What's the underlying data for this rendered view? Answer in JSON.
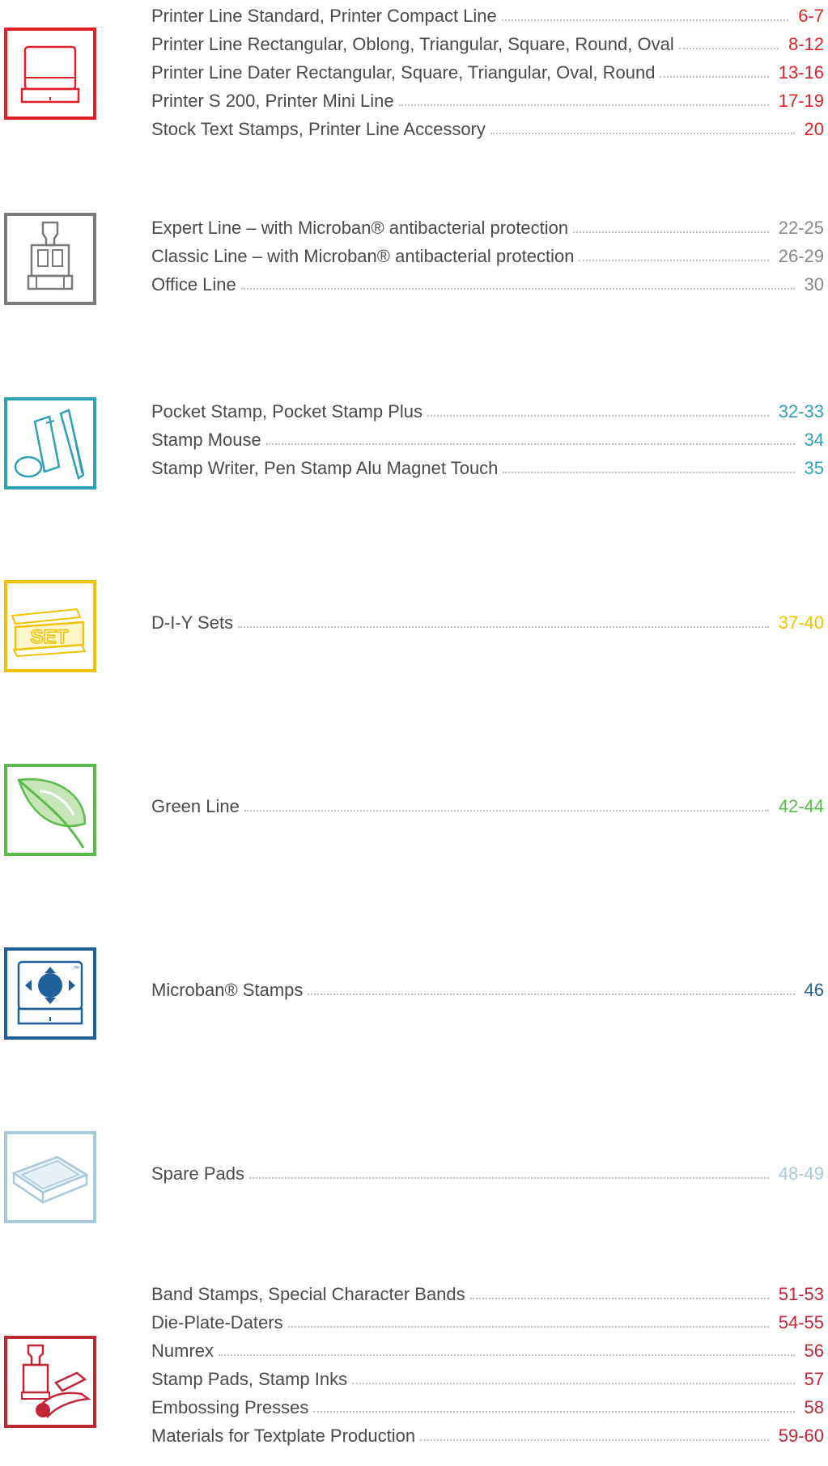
{
  "colors": {
    "printer": "#e0202a",
    "professional": "#7a7a7a",
    "mobile": "#2fa1b5",
    "diy": "#f2c200",
    "green": "#5aba4a",
    "microban": "#1f5f9a",
    "pads": "#a9c9d8",
    "traditional": "#c02636"
  },
  "sections": [
    {
      "icon": "self-inking-stamp-icon",
      "entries": [
        {
          "title": "Printer Line Standard, Printer Compact Line",
          "pages": "6-7"
        },
        {
          "title": "Printer Line Rectangular, Oblong, Triangular, Square, Round, Oval",
          "pages": "8-12"
        },
        {
          "title": "Printer Line Dater Rectangular, Square, Triangular, Oval, Round",
          "pages": "13-16"
        },
        {
          "title": "Printer S 200, Printer Mini Line",
          "pages": "17-19"
        },
        {
          "title": "Stock Text Stamps, Printer Line Accessory",
          "pages": "20"
        }
      ]
    },
    {
      "icon": "heavy-duty-stamp-icon",
      "entries": [
        {
          "title": "Expert Line – with Microban® antibacterial protection",
          "pages": "22-25"
        },
        {
          "title": "Classic Line – with Microban® antibacterial protection",
          "pages": "26-29"
        },
        {
          "title": "Office Line",
          "pages": "30"
        }
      ]
    },
    {
      "icon": "pocket-stamp-icon",
      "entries": [
        {
          "title": "Pocket Stamp, Pocket Stamp Plus",
          "pages": "32-33"
        },
        {
          "title": "Stamp Mouse",
          "pages": "34"
        },
        {
          "title": "Stamp Writer, Pen Stamp Alu Magnet Touch",
          "pages": "35"
        }
      ]
    },
    {
      "icon": "diy-set-icon",
      "icon_text": "SET",
      "entries": [
        {
          "title": "D-I-Y Sets",
          "pages": "37-40"
        }
      ]
    },
    {
      "icon": "leaf-icon",
      "entries": [
        {
          "title": "Green Line",
          "pages": "42-44"
        }
      ]
    },
    {
      "icon": "microban-stamp-icon",
      "icon_text": "™",
      "entries": [
        {
          "title": "Microban® Stamps",
          "pages": "46"
        }
      ]
    },
    {
      "icon": "spare-pad-icon",
      "entries": [
        {
          "title": "Spare Pads",
          "pages": "48-49"
        }
      ]
    },
    {
      "icon": "embossing-press-icon",
      "entries": [
        {
          "title": "Band Stamps, Special Character Bands",
          "pages": "51-53"
        },
        {
          "title": "Die-Plate-Daters",
          "pages": "54-55"
        },
        {
          "title": "Numrex",
          "pages": "56"
        },
        {
          "title": "Stamp Pads, Stamp Inks",
          "pages": "57"
        },
        {
          "title": "Embossing Presses",
          "pages": "58"
        },
        {
          "title": "Materials for Textplate Production",
          "pages": "59-60"
        }
      ]
    }
  ]
}
